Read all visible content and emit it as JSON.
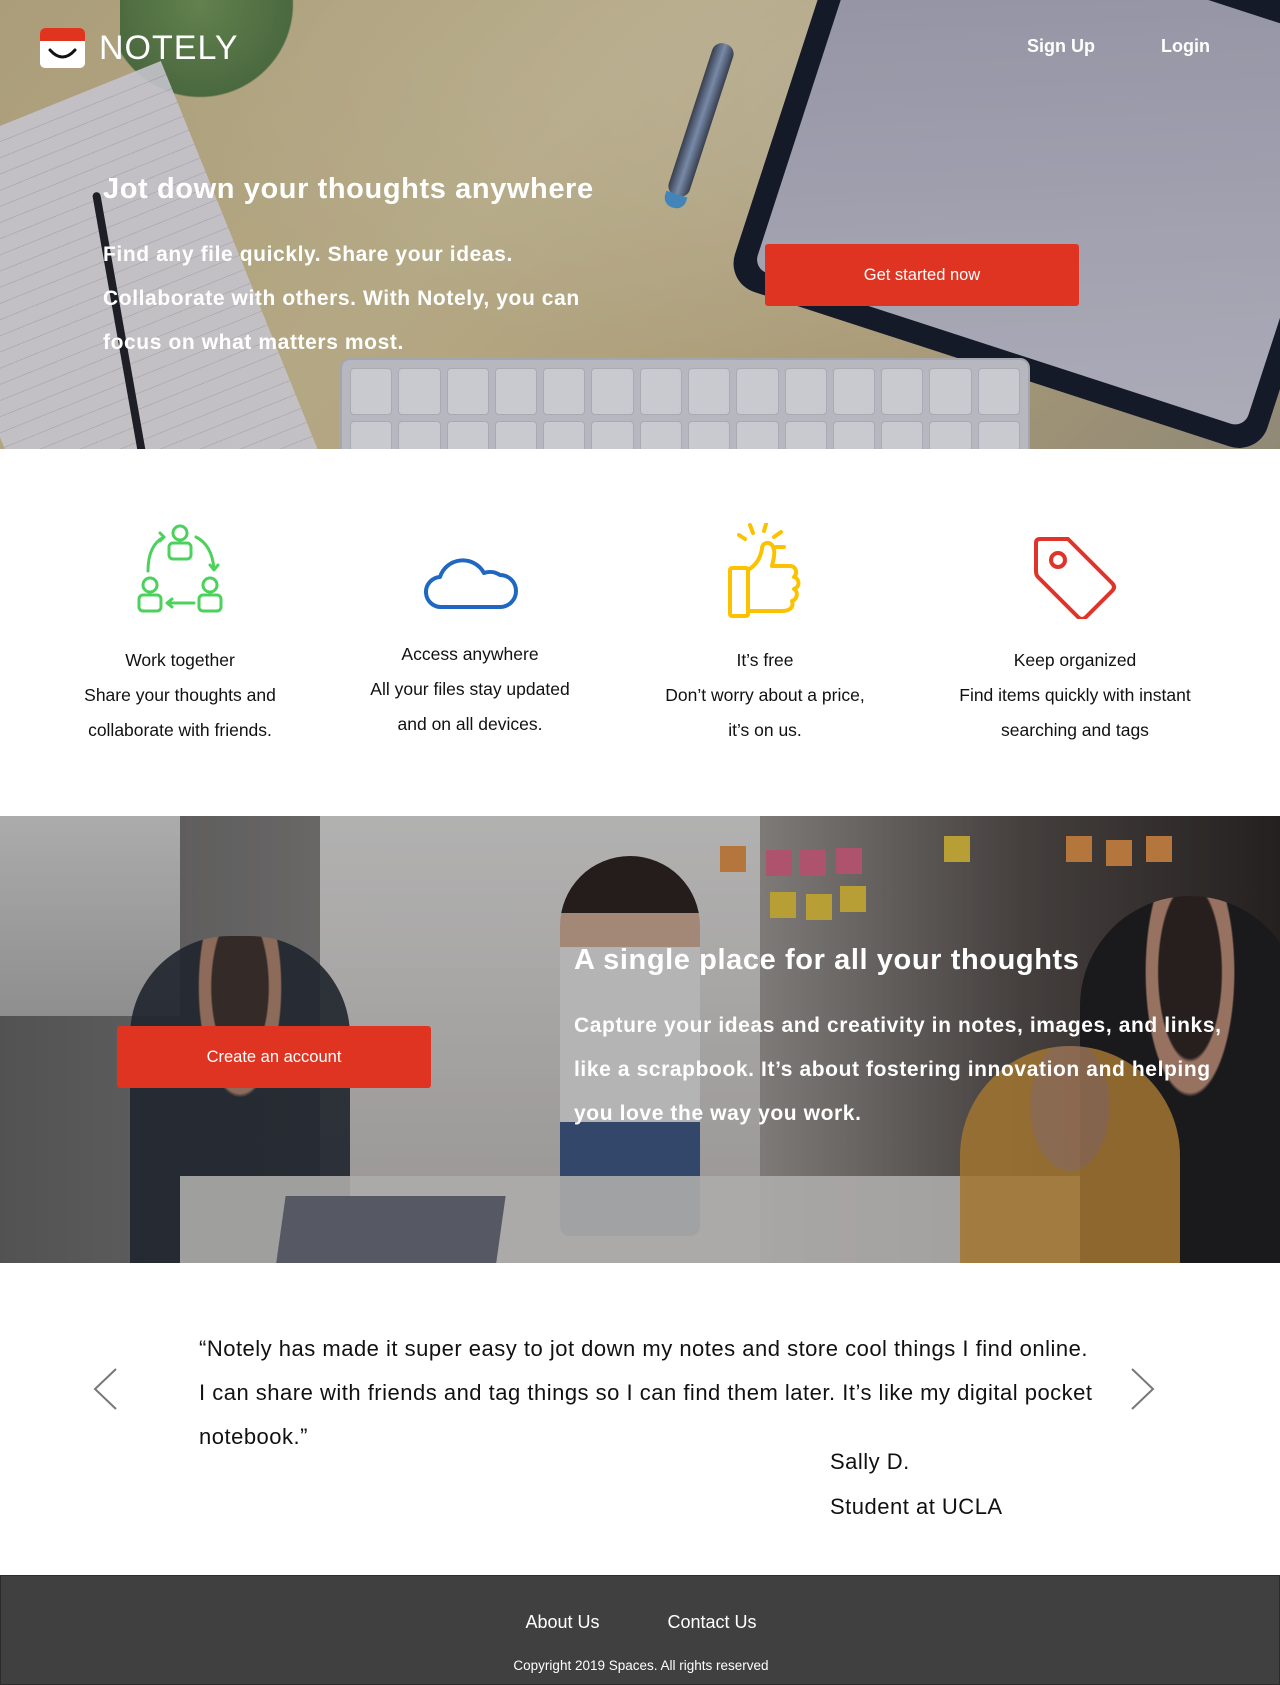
{
  "brand": {
    "name": "NOTELY",
    "accent": "#df3421",
    "logo_icon": "smile-notebook-icon"
  },
  "nav": {
    "signup": "Sign Up",
    "login": "Login"
  },
  "hero": {
    "title": "Jot down your thoughts anywhere",
    "subtitle": "Find any file quickly. Share your ideas. Collaborate with others. With Notely, you can focus on what matters most.",
    "cta": "Get started now"
  },
  "features": [
    {
      "icon": "people-cycle-icon",
      "color": "#4cd15d",
      "title": "Work together",
      "line1": "Share your thoughts and",
      "line2": "collaborate with friends."
    },
    {
      "icon": "cloud-icon",
      "color": "#1f67c0",
      "title": "Access anywhere",
      "line1": "All your files stay updated",
      "line2": "and on all devices."
    },
    {
      "icon": "thumbs-up-icon",
      "color": "#fcc200",
      "title": "It’s free",
      "line1": "Don’t worry about a price,",
      "line2": "it’s on us."
    },
    {
      "icon": "tag-icon",
      "color": "#e0342a",
      "title": "Keep organized",
      "line1": "Find items quickly with instant",
      "line2": "searching and tags"
    }
  ],
  "team": {
    "title": "A single place for all your thoughts",
    "subtitle": "Capture your ideas and creativity in notes, images, and links, like a scrapbook. It’s about fostering innovation and helping you love the way you work.",
    "cta": "Create an account"
  },
  "testimonial": {
    "quote": "“Notely has made it super easy to jot down my notes and store cool things I find online. I can share with friends and tag things so I can find them later. It’s like my digital pocket notebook.”",
    "author_name": "Sally D.",
    "author_title": "Student at UCLA",
    "prev_icon": "chevron-left-icon",
    "next_icon": "chevron-right-icon"
  },
  "footer": {
    "about": "About Us",
    "contact": "Contact Us",
    "copyright": "Copyright 2019 Spaces. All rights reserved"
  }
}
